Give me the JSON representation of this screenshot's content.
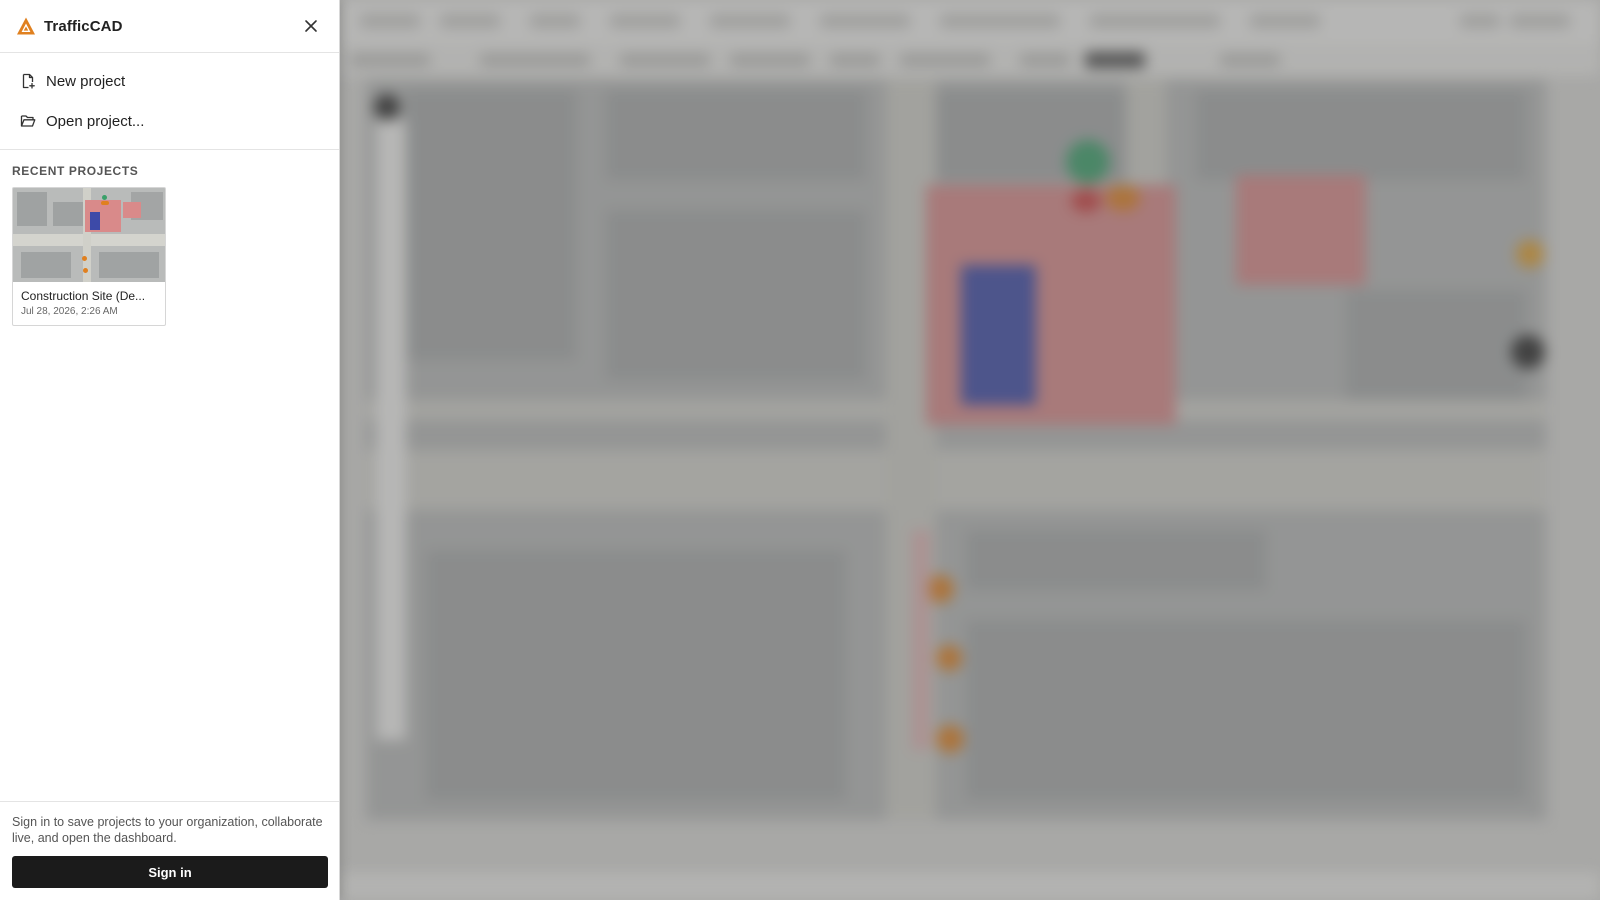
{
  "app": {
    "name": "TrafficCAD",
    "accent_color": "#e0801f"
  },
  "panel": {
    "close_icon": "close-icon",
    "menu": [
      {
        "label": "New project",
        "icon": "new-file-icon"
      },
      {
        "label": "Open project...",
        "icon": "folder-open-icon"
      }
    ],
    "recent_title": "RECENT PROJECTS",
    "recent_projects": [
      {
        "name": "Construction Site (De...",
        "date": "Jul 28, 2026, 2:26 AM"
      }
    ],
    "signin_text": "Sign in to save projects to your organization, collaborate live, and open the dashboard.",
    "signin_button": "Sign in"
  },
  "colors": {
    "zone_red": "#d98a8a",
    "zone_blue": "#3d4aa8",
    "marker_orange": "#e0801f",
    "marker_green": "#3aa06a",
    "button_dark": "#1b1b1b"
  }
}
